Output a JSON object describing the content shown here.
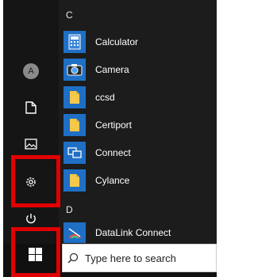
{
  "section_c": "C",
  "section_d": "D",
  "user_initial": "A",
  "apps": [
    {
      "label": "Calculator"
    },
    {
      "label": "Camera"
    },
    {
      "label": "ccsd"
    },
    {
      "label": "Certiport"
    },
    {
      "label": "Connect"
    },
    {
      "label": "Cylance"
    },
    {
      "label": "DataLink Connect"
    }
  ],
  "search": {
    "placeholder": "Type here to search"
  },
  "colors": {
    "highlight_border": "#e10000",
    "tile_blue": "#1f6fc5",
    "folder_yellow": "#f3c84b"
  }
}
